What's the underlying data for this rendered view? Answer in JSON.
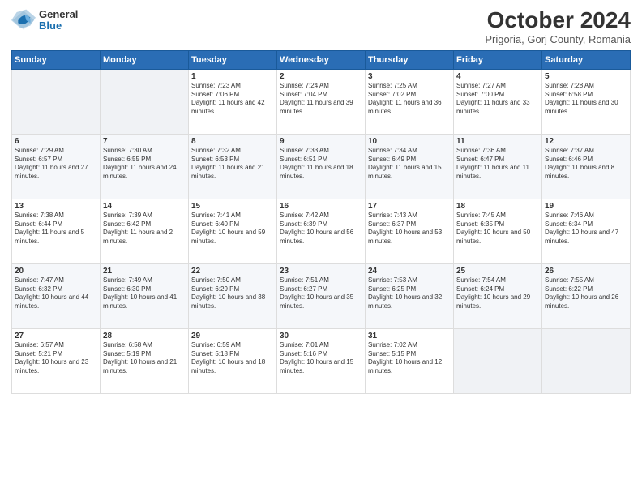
{
  "header": {
    "logo_general": "General",
    "logo_blue": "Blue",
    "month_title": "October 2024",
    "subtitle": "Prigoria, Gorj County, Romania"
  },
  "weekdays": [
    "Sunday",
    "Monday",
    "Tuesday",
    "Wednesday",
    "Thursday",
    "Friday",
    "Saturday"
  ],
  "weeks": [
    [
      {
        "num": "",
        "info": ""
      },
      {
        "num": "",
        "info": ""
      },
      {
        "num": "1",
        "info": "Sunrise: 7:23 AM\nSunset: 7:06 PM\nDaylight: 11 hours and 42 minutes."
      },
      {
        "num": "2",
        "info": "Sunrise: 7:24 AM\nSunset: 7:04 PM\nDaylight: 11 hours and 39 minutes."
      },
      {
        "num": "3",
        "info": "Sunrise: 7:25 AM\nSunset: 7:02 PM\nDaylight: 11 hours and 36 minutes."
      },
      {
        "num": "4",
        "info": "Sunrise: 7:27 AM\nSunset: 7:00 PM\nDaylight: 11 hours and 33 minutes."
      },
      {
        "num": "5",
        "info": "Sunrise: 7:28 AM\nSunset: 6:58 PM\nDaylight: 11 hours and 30 minutes."
      }
    ],
    [
      {
        "num": "6",
        "info": "Sunrise: 7:29 AM\nSunset: 6:57 PM\nDaylight: 11 hours and 27 minutes."
      },
      {
        "num": "7",
        "info": "Sunrise: 7:30 AM\nSunset: 6:55 PM\nDaylight: 11 hours and 24 minutes."
      },
      {
        "num": "8",
        "info": "Sunrise: 7:32 AM\nSunset: 6:53 PM\nDaylight: 11 hours and 21 minutes."
      },
      {
        "num": "9",
        "info": "Sunrise: 7:33 AM\nSunset: 6:51 PM\nDaylight: 11 hours and 18 minutes."
      },
      {
        "num": "10",
        "info": "Sunrise: 7:34 AM\nSunset: 6:49 PM\nDaylight: 11 hours and 15 minutes."
      },
      {
        "num": "11",
        "info": "Sunrise: 7:36 AM\nSunset: 6:47 PM\nDaylight: 11 hours and 11 minutes."
      },
      {
        "num": "12",
        "info": "Sunrise: 7:37 AM\nSunset: 6:46 PM\nDaylight: 11 hours and 8 minutes."
      }
    ],
    [
      {
        "num": "13",
        "info": "Sunrise: 7:38 AM\nSunset: 6:44 PM\nDaylight: 11 hours and 5 minutes."
      },
      {
        "num": "14",
        "info": "Sunrise: 7:39 AM\nSunset: 6:42 PM\nDaylight: 11 hours and 2 minutes."
      },
      {
        "num": "15",
        "info": "Sunrise: 7:41 AM\nSunset: 6:40 PM\nDaylight: 10 hours and 59 minutes."
      },
      {
        "num": "16",
        "info": "Sunrise: 7:42 AM\nSunset: 6:39 PM\nDaylight: 10 hours and 56 minutes."
      },
      {
        "num": "17",
        "info": "Sunrise: 7:43 AM\nSunset: 6:37 PM\nDaylight: 10 hours and 53 minutes."
      },
      {
        "num": "18",
        "info": "Sunrise: 7:45 AM\nSunset: 6:35 PM\nDaylight: 10 hours and 50 minutes."
      },
      {
        "num": "19",
        "info": "Sunrise: 7:46 AM\nSunset: 6:34 PM\nDaylight: 10 hours and 47 minutes."
      }
    ],
    [
      {
        "num": "20",
        "info": "Sunrise: 7:47 AM\nSunset: 6:32 PM\nDaylight: 10 hours and 44 minutes."
      },
      {
        "num": "21",
        "info": "Sunrise: 7:49 AM\nSunset: 6:30 PM\nDaylight: 10 hours and 41 minutes."
      },
      {
        "num": "22",
        "info": "Sunrise: 7:50 AM\nSunset: 6:29 PM\nDaylight: 10 hours and 38 minutes."
      },
      {
        "num": "23",
        "info": "Sunrise: 7:51 AM\nSunset: 6:27 PM\nDaylight: 10 hours and 35 minutes."
      },
      {
        "num": "24",
        "info": "Sunrise: 7:53 AM\nSunset: 6:25 PM\nDaylight: 10 hours and 32 minutes."
      },
      {
        "num": "25",
        "info": "Sunrise: 7:54 AM\nSunset: 6:24 PM\nDaylight: 10 hours and 29 minutes."
      },
      {
        "num": "26",
        "info": "Sunrise: 7:55 AM\nSunset: 6:22 PM\nDaylight: 10 hours and 26 minutes."
      }
    ],
    [
      {
        "num": "27",
        "info": "Sunrise: 6:57 AM\nSunset: 5:21 PM\nDaylight: 10 hours and 23 minutes."
      },
      {
        "num": "28",
        "info": "Sunrise: 6:58 AM\nSunset: 5:19 PM\nDaylight: 10 hours and 21 minutes."
      },
      {
        "num": "29",
        "info": "Sunrise: 6:59 AM\nSunset: 5:18 PM\nDaylight: 10 hours and 18 minutes."
      },
      {
        "num": "30",
        "info": "Sunrise: 7:01 AM\nSunset: 5:16 PM\nDaylight: 10 hours and 15 minutes."
      },
      {
        "num": "31",
        "info": "Sunrise: 7:02 AM\nSunset: 5:15 PM\nDaylight: 10 hours and 12 minutes."
      },
      {
        "num": "",
        "info": ""
      },
      {
        "num": "",
        "info": ""
      }
    ]
  ]
}
